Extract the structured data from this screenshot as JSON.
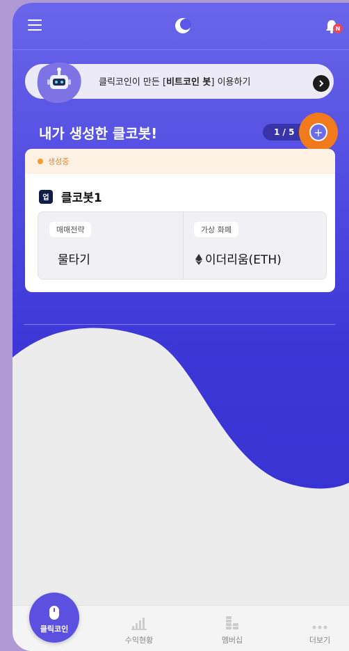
{
  "banner": {
    "text_before": "클릭코인이 만든 [",
    "text_bold": "비트코인 봇",
    "text_after": "] 이용하기"
  },
  "notification": {
    "badge": "N"
  },
  "section": {
    "title": "내가 생성한 클코봇!",
    "page_indicator": "1 / 5",
    "add_label": "+"
  },
  "bot_card": {
    "status": "생성중",
    "badge": "업",
    "name": "클코봇1",
    "strategy_label": "매매전략",
    "strategy_value": "물타기",
    "currency_label": "가상 화폐",
    "currency_value": "이더리움(ETH)"
  },
  "bottom_nav": {
    "main": "클릭코인",
    "items": [
      "수익현황",
      "멤버십",
      "더보기"
    ]
  },
  "colors": {
    "primary": "#4f4ae0",
    "accent_ring": "#f07a1c",
    "status": "#f29a2e"
  }
}
